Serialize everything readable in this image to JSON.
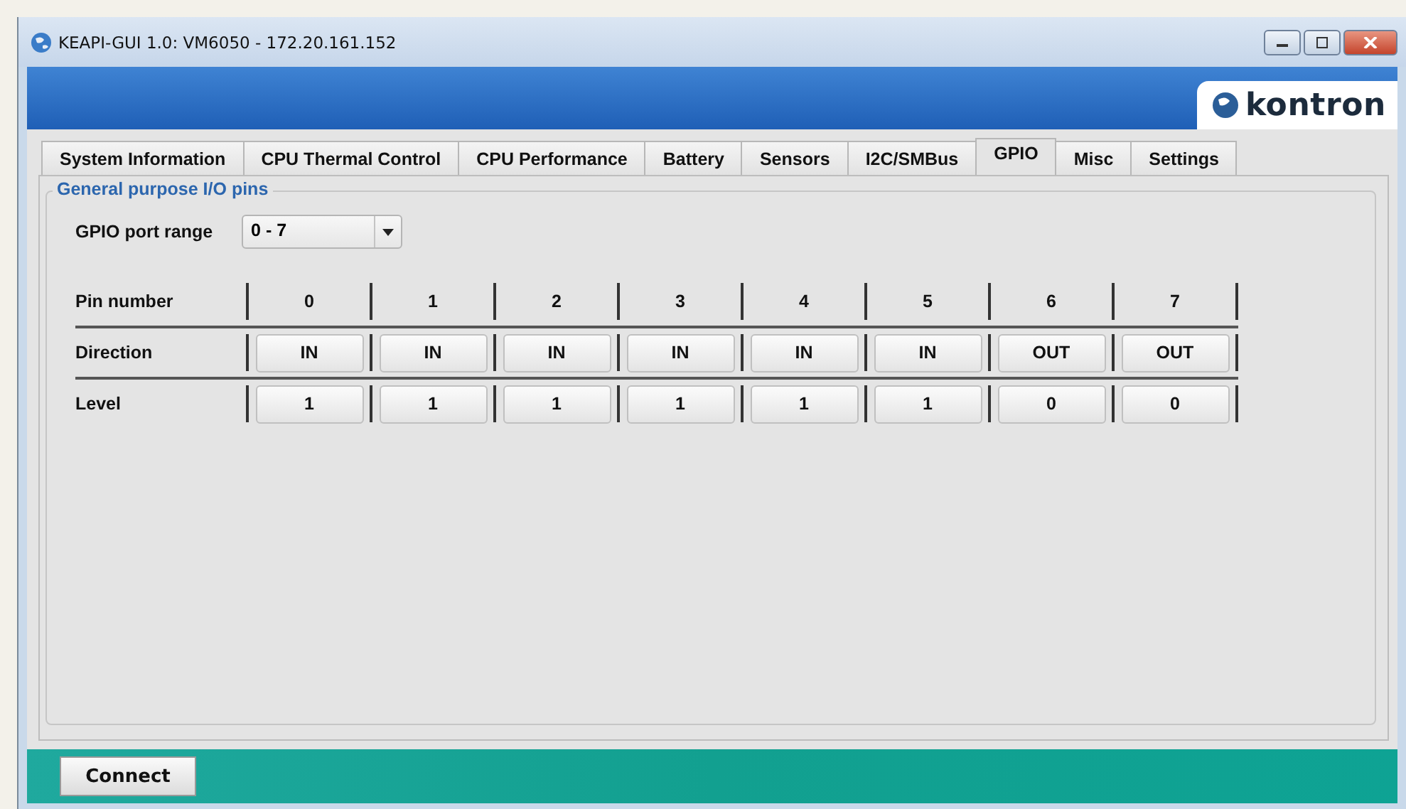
{
  "window": {
    "title": "KEAPI-GUI 1.0: VM6050 - 172.20.161.152"
  },
  "brand": {
    "logo_text": "kontron"
  },
  "tabs": [
    {
      "label": "System Information",
      "selected": false
    },
    {
      "label": "CPU Thermal Control",
      "selected": false
    },
    {
      "label": "CPU Performance",
      "selected": false
    },
    {
      "label": "Battery",
      "selected": false
    },
    {
      "label": "Sensors",
      "selected": false
    },
    {
      "label": "I2C/SMBus",
      "selected": false
    },
    {
      "label": "GPIO",
      "selected": true
    },
    {
      "label": "Misc",
      "selected": false
    },
    {
      "label": "Settings",
      "selected": false
    }
  ],
  "group": {
    "title": "General purpose I/O pins",
    "port_range": {
      "label": "GPIO port range",
      "value": "0 - 7"
    },
    "pins": {
      "header_label": "Pin number",
      "numbers": [
        "0",
        "1",
        "2",
        "3",
        "4",
        "5",
        "6",
        "7"
      ],
      "rows": [
        {
          "label": "Direction",
          "values": [
            "IN",
            "IN",
            "IN",
            "IN",
            "IN",
            "IN",
            "OUT",
            "OUT"
          ]
        },
        {
          "label": "Level",
          "values": [
            "1",
            "1",
            "1",
            "1",
            "1",
            "1",
            "0",
            "0"
          ]
        }
      ]
    }
  },
  "footer": {
    "button": "Connect"
  }
}
